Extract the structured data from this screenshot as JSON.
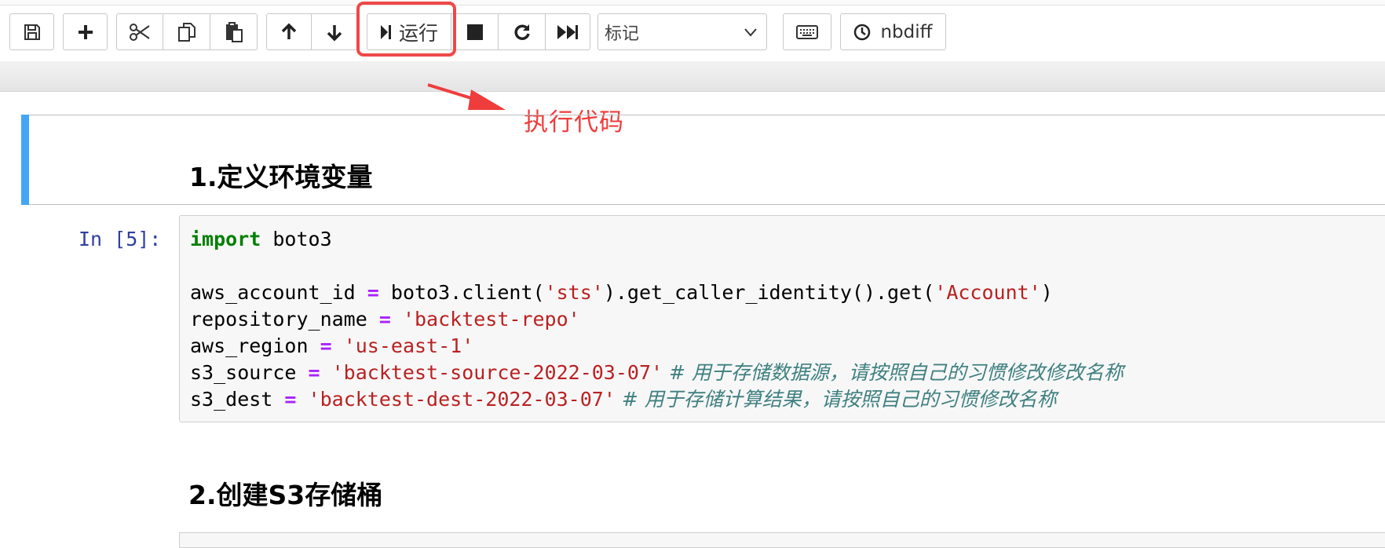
{
  "toolbar": {
    "run_label": "运行",
    "cell_type_selected": "标记",
    "nbdiff_label": "nbdiff",
    "icons": [
      "save-icon",
      "plus-icon",
      "scissors-icon",
      "copy-icon",
      "paste-icon",
      "arrow-up-icon",
      "arrow-down-icon",
      "step-icon",
      "stop-icon",
      "restart-icon",
      "fast-forward-icon",
      "chevron-down-icon",
      "keyboard-icon",
      "clock-icon"
    ]
  },
  "annotation": {
    "label": "执行代码",
    "color": "#ef3c3c"
  },
  "cells": {
    "heading_1": "1.定义环境变量",
    "prompt": "In [5]:",
    "heading_2": "2.创建S3存储桶"
  },
  "code": {
    "l1_kw": "import",
    "l1_rest": " boto3",
    "l3_a": "aws_account_id ",
    "l3_op": "=",
    "l3_b": " boto3.client(",
    "l3_s1": "'sts'",
    "l3_c": ").get_caller_identity().get(",
    "l3_s2": "'Account'",
    "l3_d": ")",
    "l4_a": "repository_name ",
    "l4_op": "=",
    "l4_s": " 'backtest-repo'",
    "l5_a": "aws_region ",
    "l5_op": "=",
    "l5_s": " 'us-east-1'",
    "l6_a": "s3_source ",
    "l6_op": "=",
    "l6_s": " 'backtest-source-2022-03-07'",
    "l6_c": " # 用于存储数据源，请按照自己的习惯修改修改名称",
    "l7_a": "s3_dest ",
    "l7_op": "=",
    "l7_s": " 'backtest-dest-2022-03-07'",
    "l7_c": " # 用于存储计算结果，请按照自己的习惯修改名称"
  },
  "colors": {
    "highlight": "#ef4848",
    "cell_bar": "#42a5f5",
    "keyword": "#008000",
    "operator": "#aa22ff",
    "string": "#ba2121",
    "comment": "#408080",
    "prompt": "#303f9f"
  }
}
